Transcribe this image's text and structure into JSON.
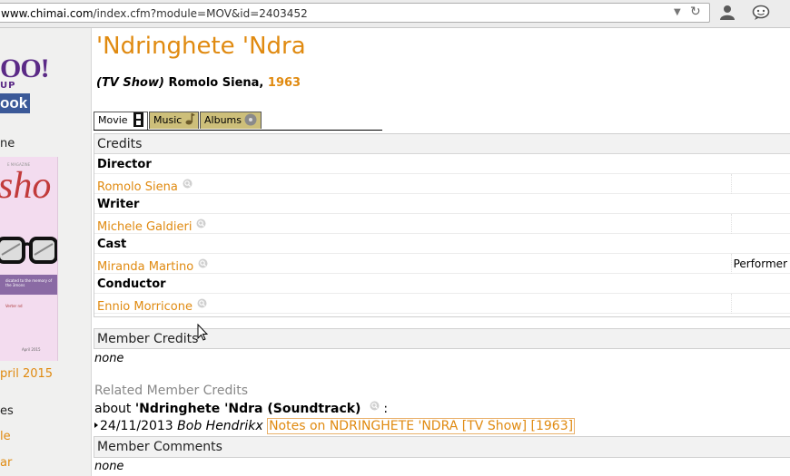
{
  "browser": {
    "url_host": "www.chimai.com",
    "url_path": "/index.cfm?module=MOV&id=2403452"
  },
  "sidebar": {
    "yahoo_logo": "OO!",
    "yahoo_sub": "UP",
    "facebook_logo": "ook",
    "home_label": "ne",
    "magazine": {
      "title": "sho",
      "band_text": "dicated to the memory of the 3mons",
      "small_text": "Verter nd",
      "date": "April 2015",
      "header": "E MAGAZINE"
    },
    "april_link": "pril 2015",
    "es_label": "es",
    "le_link": "le",
    "ar_link": "ar"
  },
  "main": {
    "title": "'Ndringhete 'Ndra",
    "subtitle_type": "(TV Show)",
    "subtitle_person": "Romolo Siena,",
    "subtitle_year": "1963",
    "tabs": [
      {
        "label": "Movie"
      },
      {
        "label": "Music"
      },
      {
        "label": "Albums"
      }
    ],
    "credits": {
      "title": "Credits",
      "rows": [
        {
          "role": "Director",
          "person": "Romolo Siena",
          "note": ""
        },
        {
          "role": "Writer",
          "person": "Michele Galdieri",
          "note": ""
        },
        {
          "role": "Cast",
          "person": "Miranda Martino",
          "note": "Performer"
        },
        {
          "role": "Conductor",
          "person": "Ennio Morricone",
          "note": ""
        }
      ]
    },
    "member_credits": {
      "title": "Member Credits",
      "empty": "none"
    },
    "related": {
      "title": "Related Member Credits",
      "about_prefix": "about",
      "about_name": "'Ndringhete 'Ndra (Soundtrack)",
      "about_suffix": ":",
      "entry_date": "24/11/2013",
      "entry_author": "Bob Hendrikx",
      "entry_link": "Notes on NDRINGHETE 'NDRA [TV Show] [1963]"
    },
    "member_comments": {
      "title": "Member Comments",
      "empty": "none"
    }
  },
  "colors": {
    "accent": "#e08a10",
    "tab_inactive": "#cdbf7a",
    "header_bg": "#f2f2f2"
  }
}
